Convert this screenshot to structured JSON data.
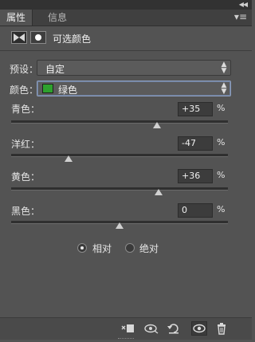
{
  "tabs": {
    "active": "属性",
    "inactive": "信息"
  },
  "header": {
    "title": "可选颜色"
  },
  "preset": {
    "label": "预设：",
    "value": "自定"
  },
  "colors": {
    "label": "颜色：",
    "value": "绿色",
    "swatch_color": "#2ea12e"
  },
  "sliders": [
    {
      "label": "青色：",
      "value": "+35",
      "unit": "%",
      "level": 35
    },
    {
      "label": "洋红：",
      "value": "-47",
      "unit": "%",
      "level": -47
    },
    {
      "label": "黄色：",
      "value": "+36",
      "unit": "%",
      "level": 36
    },
    {
      "label": "黑色：",
      "value": "0",
      "unit": "%",
      "level": 0
    }
  ],
  "method": {
    "relative": "相对",
    "absolute": "绝对",
    "selected": "relative"
  },
  "icons": {
    "collapse": "double-chevron-icon",
    "menu": "panel-menu-icon",
    "bottom": [
      "clip-to-layer-icon",
      "view-previous-state-icon",
      "reset-icon",
      "visibility-eye-icon",
      "trash-icon"
    ]
  }
}
